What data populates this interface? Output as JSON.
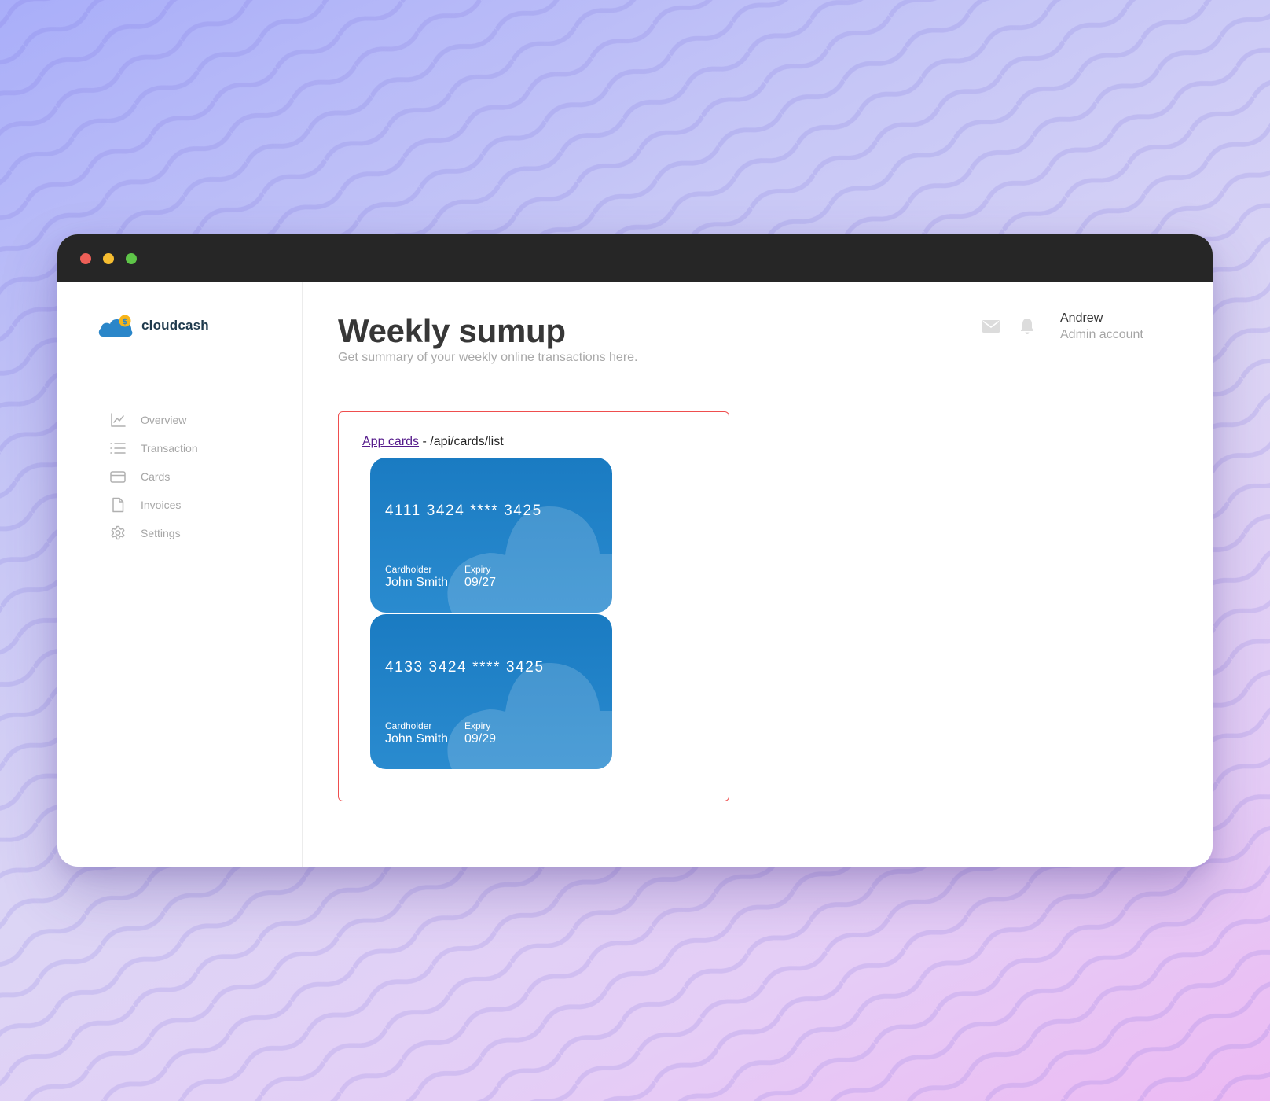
{
  "app": {
    "name": "cloudcash"
  },
  "sidebar": {
    "items": [
      {
        "label": "Overview",
        "icon": "chart-line-icon"
      },
      {
        "label": "Transaction",
        "icon": "list-icon"
      },
      {
        "label": "Cards",
        "icon": "credit-card-icon"
      },
      {
        "label": "Invoices",
        "icon": "document-icon"
      },
      {
        "label": "Settings",
        "icon": "gear-icon"
      }
    ]
  },
  "header": {
    "title": "Weekly sumup",
    "subtitle": "Get summary of your weekly online transactions here.",
    "icons": [
      "mail-icon",
      "bell-icon"
    ],
    "user": {
      "name": "Andrew",
      "role": "Admin account"
    }
  },
  "cards_panel": {
    "link_label": "App cards",
    "endpoint": " - /api/cards/list",
    "cards": [
      {
        "number": "4111 3424 **** 3425",
        "holder_label": "Cardholder",
        "holder": "John Smith",
        "expiry_label": "Expiry",
        "expiry": "09/27"
      },
      {
        "number": "4133 3424 **** 3425",
        "holder_label": "Cardholder",
        "holder": "John Smith",
        "expiry_label": "Expiry",
        "expiry": "09/29"
      }
    ]
  },
  "colors": {
    "card_blue": "#1a7bc2",
    "panel_border": "#ef4e4e",
    "titlebar": "#262626",
    "link": "#551a8b"
  }
}
